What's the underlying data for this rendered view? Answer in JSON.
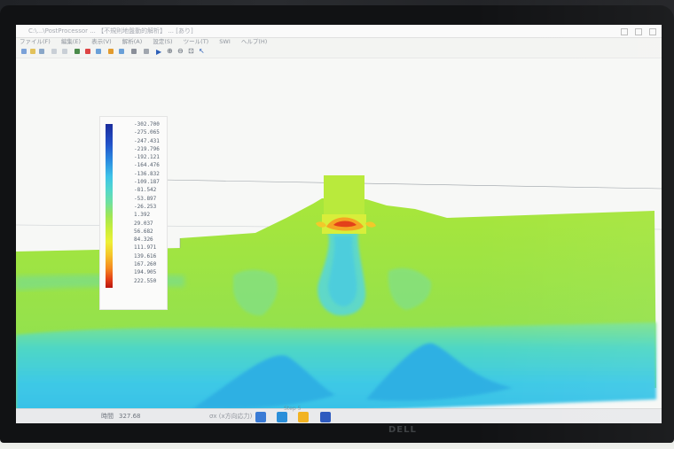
{
  "window": {
    "title": "C:\\...\\PostProcessor ... 【不規則地盤動的解析】 ... [あり]",
    "menu": [
      "ファイル(F)",
      "編集(E)",
      "表示(V)",
      "解析(A)",
      "設定(S)",
      "ツール(T)",
      "SWI",
      "ヘルプ(H)"
    ]
  },
  "toolbar": {
    "icons": [
      "new-icon",
      "open-icon",
      "save-icon",
      "play-icon",
      "zoom-in-icon",
      "zoom-out-icon",
      "pointer-icon"
    ]
  },
  "legend": {
    "values": [
      "-302.700",
      "-275.065",
      "-247.431",
      "-219.796",
      "-192.121",
      "-164.476",
      "-136.832",
      "-109.187",
      "-81.542",
      "-53.897",
      "-26.253",
      "1.392",
      "29.037",
      "56.682",
      "84.326",
      "111.971",
      "139.616",
      "167.260",
      "194.905",
      "222.550"
    ]
  },
  "status": {
    "time_label": "時間",
    "time_value": "327.68",
    "component": "σx (x方向応力)",
    "step": "Step 5"
  },
  "brand": "DELL"
}
